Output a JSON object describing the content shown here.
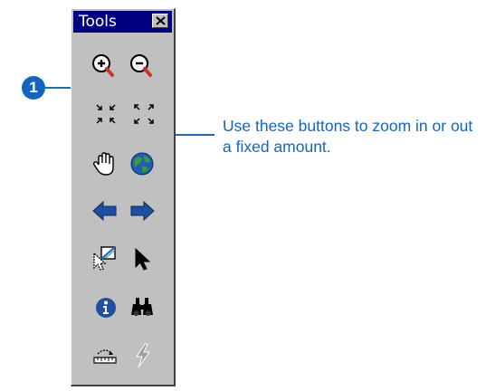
{
  "toolbar": {
    "title": "Tools",
    "tools": [
      {
        "icon": "zoom-in-icon",
        "label": "Zoom In"
      },
      {
        "icon": "zoom-out-icon",
        "label": "Zoom Out"
      },
      {
        "icon": "fixed-zoom-in-icon",
        "label": "Fixed Zoom In"
      },
      {
        "icon": "fixed-zoom-out-icon",
        "label": "Fixed Zoom Out"
      },
      {
        "icon": "pan-hand-icon",
        "label": "Pan"
      },
      {
        "icon": "full-extent-globe-icon",
        "label": "Full Extent"
      },
      {
        "icon": "back-arrow-icon",
        "label": "Go Back"
      },
      {
        "icon": "forward-arrow-icon",
        "label": "Go Forward"
      },
      {
        "icon": "select-features-icon",
        "label": "Select Features"
      },
      {
        "icon": "select-elements-icon",
        "label": "Select Elements"
      },
      {
        "icon": "identify-icon",
        "label": "Identify"
      },
      {
        "icon": "find-binoculars-icon",
        "label": "Find"
      },
      {
        "icon": "measure-icon",
        "label": "Measure"
      },
      {
        "icon": "hyperlink-lightning-icon",
        "label": "Hyperlink"
      }
    ]
  },
  "callout": {
    "number": "1",
    "text": "Use these buttons to zoom in or out a fixed amount."
  },
  "colors": {
    "callout": "#1565c0",
    "titlebar": "#000080",
    "panel": "#c0c0c0"
  }
}
